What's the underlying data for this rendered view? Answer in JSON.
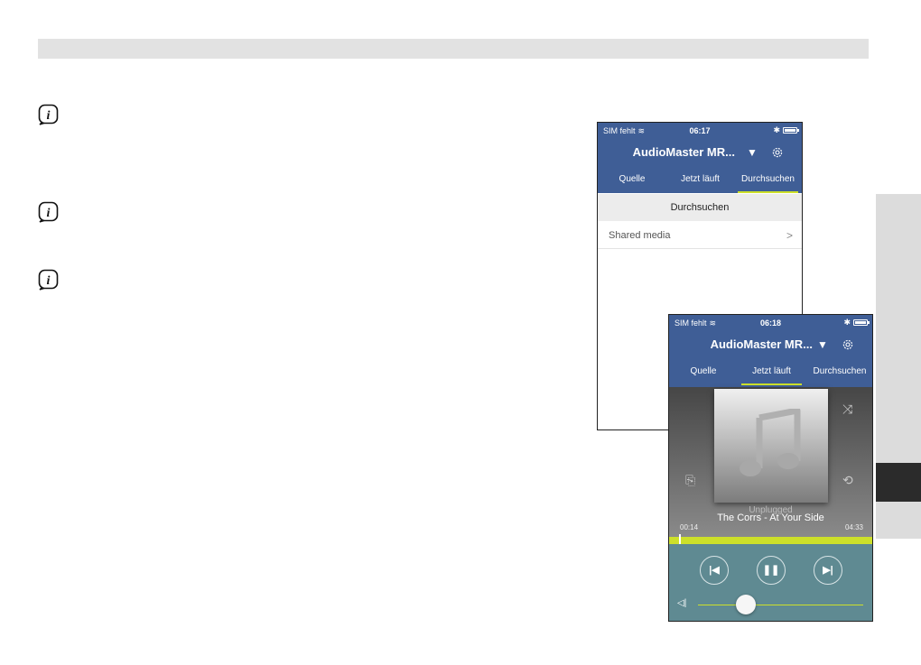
{
  "browse_screen": {
    "status": {
      "carrier": "SIM fehlt",
      "time": "06:17"
    },
    "device_name": "AudioMaster MR...",
    "tabs": [
      {
        "label": "Quelle",
        "active": false
      },
      {
        "label": "Jetzt läuft",
        "active": false
      },
      {
        "label": "Durchsuchen",
        "active": true
      }
    ],
    "section_title": "Durchsuchen",
    "items": [
      {
        "label": "Shared media"
      }
    ]
  },
  "now_playing_screen": {
    "status": {
      "carrier": "SIM fehlt",
      "time": "06:18"
    },
    "device_name": "AudioMaster MR...",
    "tabs": [
      {
        "label": "Quelle",
        "active": false
      },
      {
        "label": "Jetzt läuft",
        "active": true
      },
      {
        "label": "Durchsuchen",
        "active": false
      }
    ],
    "album": "Unplugged",
    "track": "The Corrs - At Your Side",
    "elapsed": "00:14",
    "total": "04:33",
    "progress_fraction": 0.05,
    "volume_fraction": 0.29
  },
  "icons": {
    "info": "info-icon",
    "gear": "gear-icon",
    "dropdown": "triangle-down-icon",
    "shuffle": "shuffle-icon",
    "share": "share-icon",
    "repeat": "repeat-icon",
    "previous": "skip-previous-icon",
    "pause": "pause-icon",
    "next": "skip-next-icon",
    "volume": "speaker-icon",
    "music_note": "music-note-icon"
  },
  "colors": {
    "header_blue": "#3f5e96",
    "accent_yellow_green": "#cde02a",
    "controls_teal": "#5f8a92",
    "side_tab_dark": "#2b2b2b"
  }
}
